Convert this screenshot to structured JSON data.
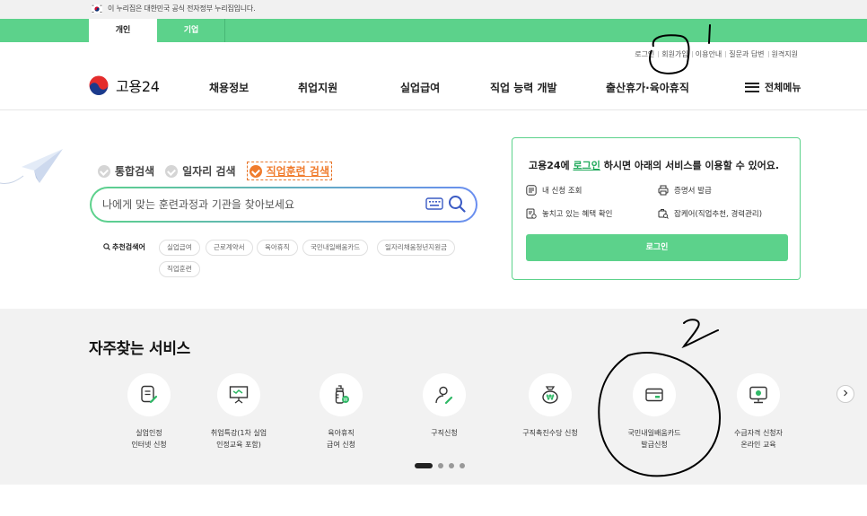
{
  "gov_banner": {
    "text": "이 누리집은 대한민국 공식 전자정부 누리집입니다."
  },
  "top_tabs": {
    "personal": "개인",
    "company": "기업"
  },
  "util_links": [
    "로그인",
    "회원가입",
    "이용안내",
    "질문과 답변",
    "원격지원"
  ],
  "logo": {
    "name": "고용24"
  },
  "nav": {
    "items": [
      "채용정보",
      "취업지원",
      "실업급여",
      "직업 능력 개발",
      "출산휴가·육아휴직"
    ],
    "menu_all": "전체메뉴"
  },
  "search": {
    "options": [
      "통합검색",
      "일자리 검색",
      "직업훈련 검색"
    ],
    "selected": "직업훈련 검색",
    "placeholder": "나에게 맞는 훈련과정과 기관을 찾아보세요",
    "recommend_label": "추천검색어",
    "recommend_chips": [
      "실업급여",
      "근로계약서",
      "육아휴직",
      "국민내일배움카드",
      "일자리채움청년지원금",
      "직업훈련"
    ]
  },
  "login_panel": {
    "title_pre": "고용24에 ",
    "title_link": "로그인",
    "title_post": " 하시면 아래의 서비스를 이용할 수 있어요.",
    "services": [
      "내 신청 조회",
      "증명서 발급",
      "놓치고 있는 혜택 확인",
      "잡케어(직업추천, 경력관리)"
    ],
    "login_button": "로그인"
  },
  "frequent": {
    "heading": "자주찾는 서비스",
    "items": [
      {
        "label": "실업인정\n인터넷 신청",
        "icon": "document-edit-icon"
      },
      {
        "label": "취업특강(1차 실업\n인정교육 포함)",
        "icon": "presentation-board-icon"
      },
      {
        "label": "육아휴직\n급여 신청",
        "icon": "baby-bottle-icon"
      },
      {
        "label": "구직신청",
        "icon": "person-edit-icon"
      },
      {
        "label": "구직촉진수당 신청",
        "icon": "won-pouch-icon"
      },
      {
        "label": "국민내일배움카드\n발급신청",
        "icon": "card-icon"
      },
      {
        "label": "수급자격 신청자\n온라인 교육",
        "icon": "monitor-icon"
      }
    ]
  },
  "colors": {
    "brand_green": "#5cd28b",
    "accent_orange": "#f07c2d"
  }
}
